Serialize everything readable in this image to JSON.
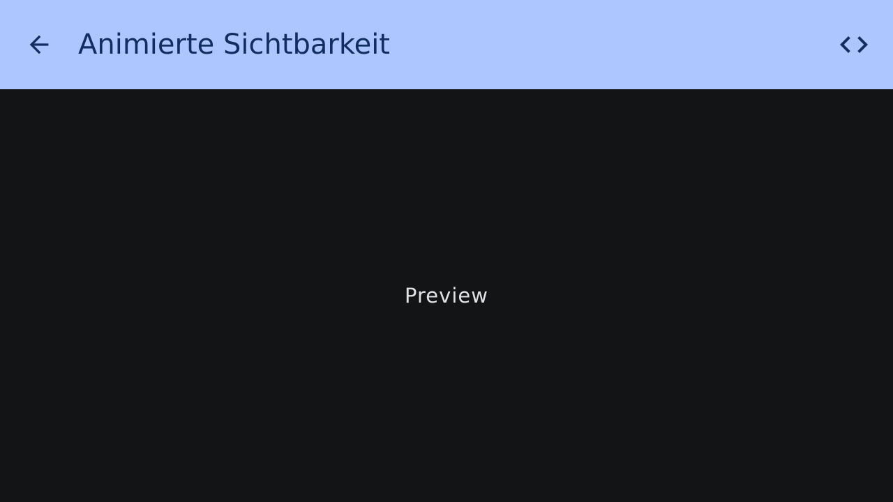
{
  "app_bar": {
    "title": "Animierte Sichtbarkeit",
    "back_icon": "arrow-back-icon",
    "code_icon": "code-icon",
    "background_color": "#adc6ff",
    "foreground_color": "#102f60"
  },
  "content": {
    "preview_label": "Preview",
    "background_color": "#131416",
    "text_color": "#e2e2e6"
  }
}
